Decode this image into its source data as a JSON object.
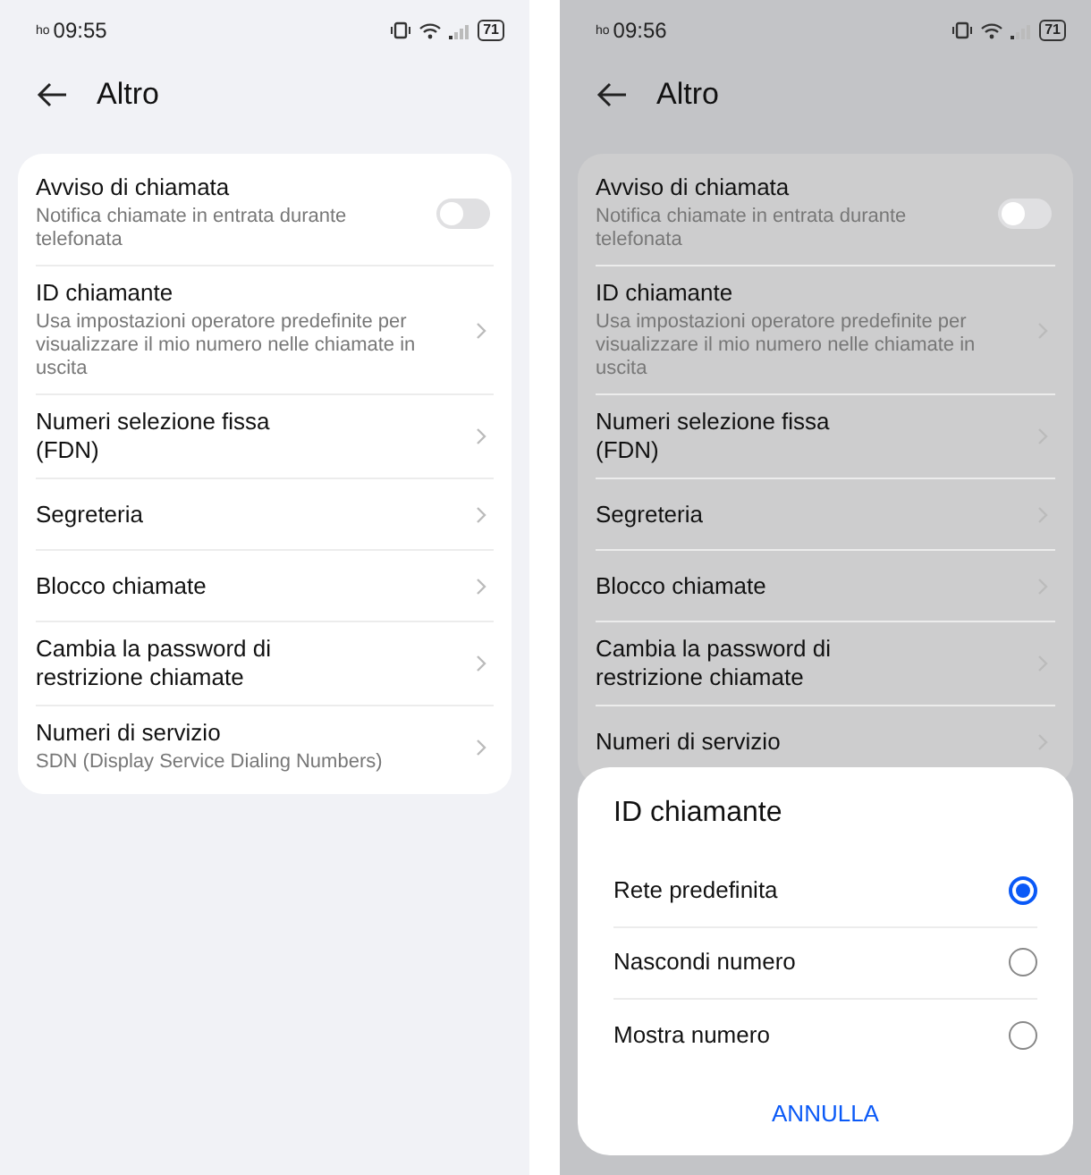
{
  "screens": [
    {
      "status_bar": {
        "carrier": "ho",
        "time": "09:55",
        "battery": "71"
      },
      "title": "Altro",
      "dimmed": false,
      "items": [
        {
          "kind": "toggle",
          "title": "Avviso di chiamata",
          "subtitle": "Notifica chiamate in entrata durante telefonata",
          "on": false
        },
        {
          "kind": "link",
          "title": "ID chiamante",
          "subtitle": "Usa impostazioni operatore predefinite per visualizzare il mio numero nelle chiamate in uscita"
        },
        {
          "kind": "link",
          "title": "Numeri selezione fissa (FDN)"
        },
        {
          "kind": "link",
          "title": "Segreteria"
        },
        {
          "kind": "link",
          "title": "Blocco chiamate"
        },
        {
          "kind": "link",
          "title": "Cambia la password di restrizione chiamate"
        },
        {
          "kind": "link",
          "title": "Numeri di servizio",
          "subtitle": "SDN (Display Service Dialing Numbers)"
        }
      ]
    },
    {
      "status_bar": {
        "carrier": "ho",
        "time": "09:56",
        "battery": "71"
      },
      "title": "Altro",
      "dimmed": true,
      "items": [
        {
          "kind": "toggle",
          "title": "Avviso di chiamata",
          "subtitle": "Notifica chiamate in entrata durante telefonata",
          "on": false
        },
        {
          "kind": "link",
          "title": "ID chiamante",
          "subtitle": "Usa impostazioni operatore predefinite per visualizzare il mio numero nelle chiamate in uscita"
        },
        {
          "kind": "link",
          "title": "Numeri selezione fissa (FDN)"
        },
        {
          "kind": "link",
          "title": "Segreteria"
        },
        {
          "kind": "link",
          "title": "Blocco chiamate"
        },
        {
          "kind": "link",
          "title": "Cambia la password di restrizione chiamate"
        },
        {
          "kind": "link",
          "title": "Numeri di servizio"
        }
      ],
      "dialog": {
        "title": "ID chiamante",
        "options": [
          {
            "label": "Rete predefinita",
            "selected": true
          },
          {
            "label": "Nascondi numero",
            "selected": false
          },
          {
            "label": "Mostra numero",
            "selected": false
          }
        ],
        "cancel": "ANNULLA"
      }
    }
  ]
}
